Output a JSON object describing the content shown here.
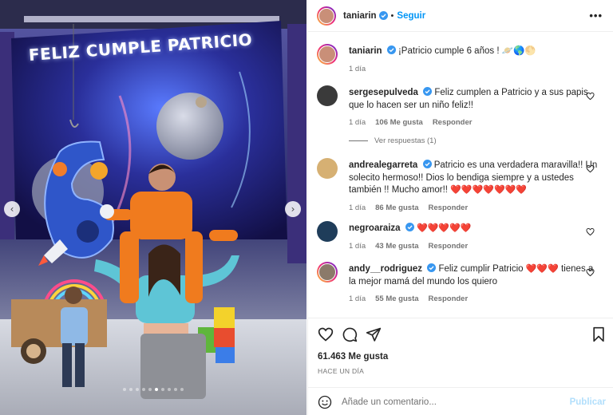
{
  "post": {
    "author": "taniarin",
    "follow_label": "Seguir",
    "more_label": "•••",
    "separator": "•"
  },
  "media": {
    "banner_text": "FELIZ CUMPLE PATRICIO",
    "prev_label": "‹",
    "next_label": "›",
    "slide_count": 10,
    "active_slide": 6
  },
  "caption": {
    "user": "taniarin",
    "text": "¡Patricio cumple 6 años ! 🪐🌎🌕",
    "time": "1 día"
  },
  "comments": [
    {
      "user": "sergesepulveda",
      "verified": true,
      "text": "Feliz cumplen a Patricio y a sus papis que lo hacen ser un niño feliz!!",
      "time": "1 día",
      "likes": "106 Me gusta",
      "reply": "Responder"
    },
    {
      "user": "andrealegarreta",
      "verified": true,
      "text": "Patricio es una verdadera maravilla!! Un solecito hermoso!! Dios lo bendiga siempre y a ustedes también !! Mucho amor!! ",
      "hearts": "❤️❤️❤️❤️❤️❤️❤️",
      "time": "1 día",
      "likes": "86 Me gusta",
      "reply": "Responder"
    },
    {
      "user": "negroaraiza",
      "verified": true,
      "text": "",
      "hearts": "❤️❤️❤️❤️❤️",
      "time": "1 día",
      "likes": "43 Me gusta",
      "reply": "Responder"
    },
    {
      "user": "andy__rodriguez",
      "verified": true,
      "text_before": "Feliz cumplir Patricio ",
      "hearts": "❤️❤️❤️",
      "text_after": " tienes a la mejor mamá del mundo los quiero",
      "time": "1 día",
      "likes": "55 Me gusta",
      "reply": "Responder"
    }
  ],
  "view_replies": "Ver respuestas (1)",
  "likes_total": "61.463 Me gusta",
  "posted_ago": "HACE UN DÍA",
  "add_comment": {
    "placeholder": "Añade un comentario...",
    "publish": "Publicar"
  },
  "icons": {
    "like": "heart-outline-icon",
    "comment": "comment-bubble-icon",
    "share": "paper-plane-icon",
    "save": "bookmark-icon",
    "emoji": "smiley-icon"
  },
  "colors": {
    "link_blue": "#0095f6",
    "publish_disabled": "#b2dffc",
    "heart_red": "#ed4956",
    "verified_blue": "#3897f0"
  }
}
